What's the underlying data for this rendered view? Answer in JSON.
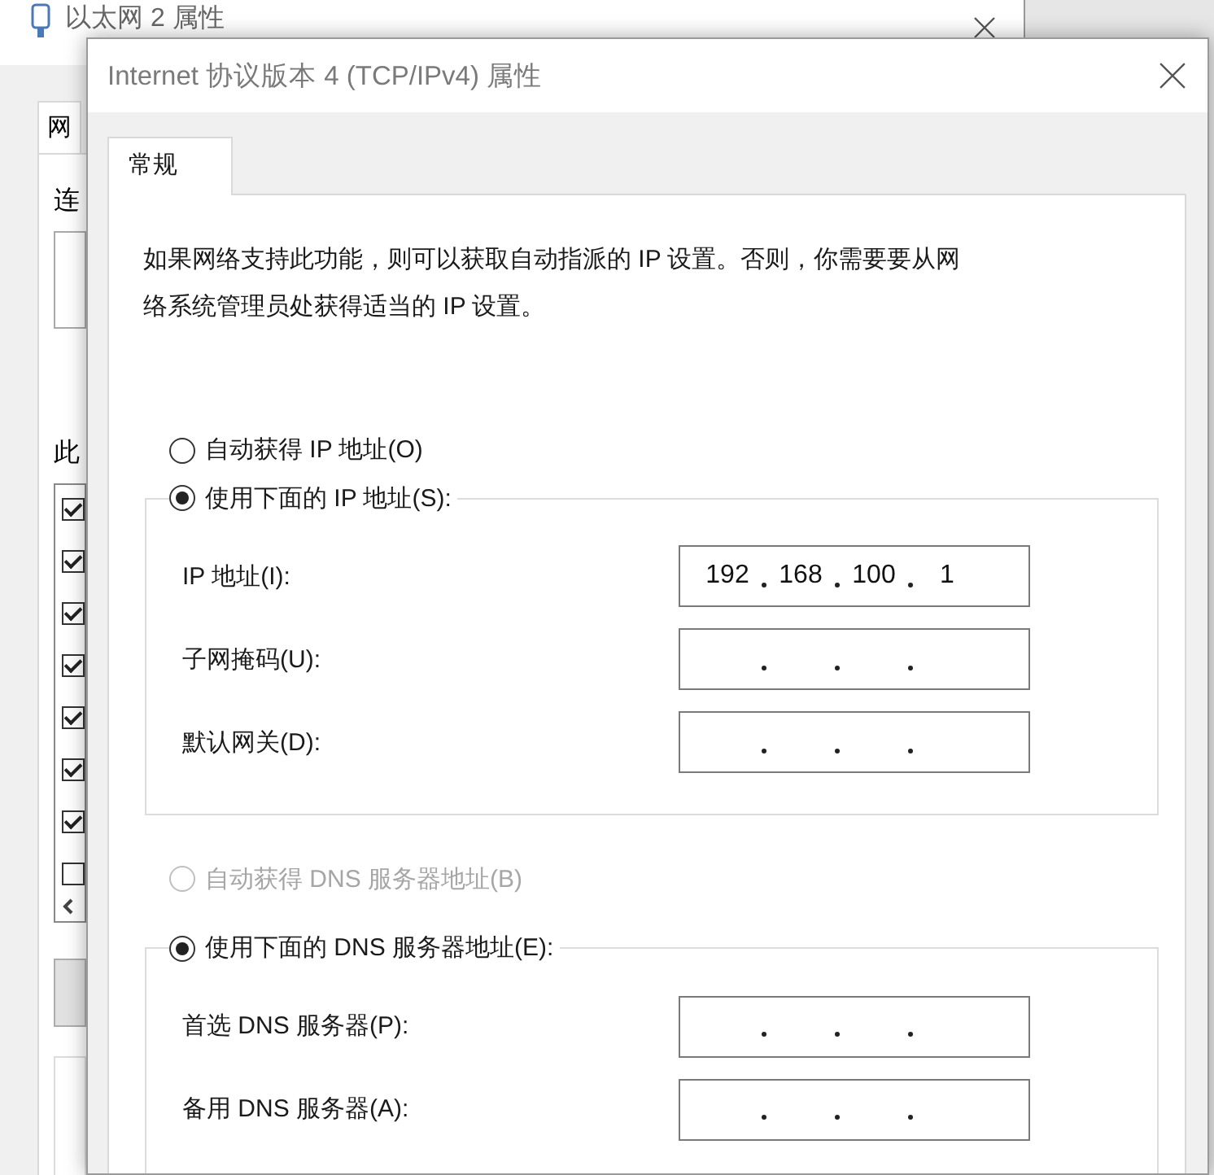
{
  "background_window": {
    "title": "以太网 2 属性",
    "tabs": [
      {
        "label": "网",
        "selected": true
      }
    ],
    "labels": [
      "连",
      "此"
    ],
    "checkboxes": [
      {
        "checked": true
      },
      {
        "checked": true
      },
      {
        "checked": true
      },
      {
        "checked": true
      },
      {
        "checked": true
      },
      {
        "checked": true
      },
      {
        "checked": true
      },
      {
        "checked": false
      }
    ]
  },
  "dialog": {
    "title": "Internet 协议版本 4 (TCP/IPv4) 属性",
    "tabs": [
      {
        "label": "常规",
        "selected": true
      }
    ],
    "description": "如果网络支持此功能，则可以获取自动指派的 IP 设置。否则，你需要要从网络系统管理员处获得适当的 IP 设置。",
    "sections": [
      {
        "options": [
          {
            "label": "自动获得 IP 地址(O)",
            "selected": false,
            "disabled": false
          },
          {
            "label": "使用下面的 IP 地址(S):",
            "selected": true,
            "disabled": false
          }
        ],
        "fields": [
          {
            "label": "IP 地址(I):",
            "octets": [
              "192",
              "168",
              "100",
              "1"
            ]
          },
          {
            "label": "子网掩码(U):"
          },
          {
            "label": "默认网关(D):"
          }
        ]
      },
      {
        "options": [
          {
            "label": "自动获得 DNS 服务器地址(B)",
            "selected": false,
            "disabled": true
          },
          {
            "label": "使用下面的 DNS 服务器地址(E):",
            "selected": true,
            "disabled": false
          }
        ],
        "fields": [
          {
            "label": "首选 DNS 服务器(P):"
          },
          {
            "label": "备用 DNS 服务器(A):"
          }
        ]
      }
    ]
  }
}
